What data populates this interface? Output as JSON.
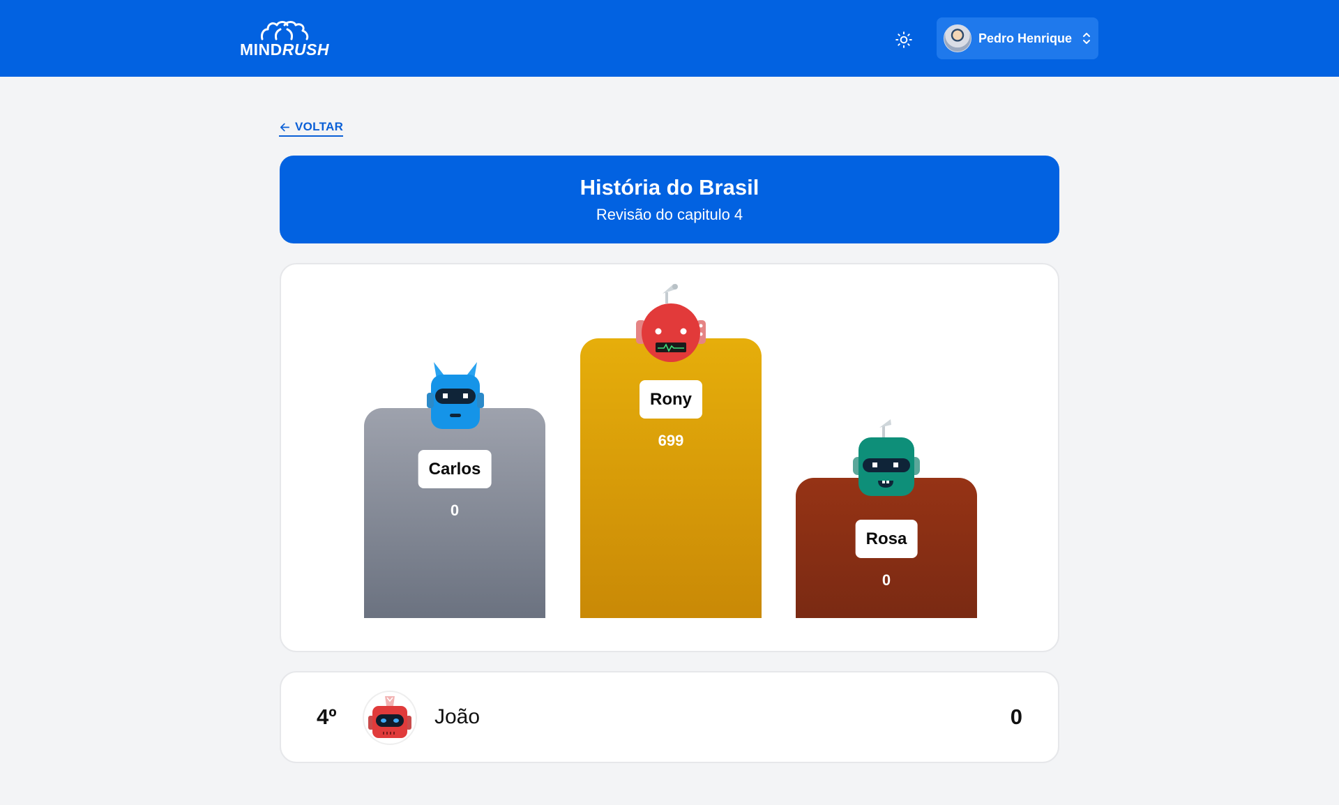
{
  "header": {
    "logo_prefix": "MIND",
    "logo_suffix": "RUSH",
    "user_name": "Pedro Henrique",
    "theme_icon": "sun-icon",
    "user_menu_icon": "chevron-up-down-icon",
    "brand_color": "#0262e1"
  },
  "nav": {
    "back_label": "VOLTAR",
    "back_icon": "arrow-left-icon"
  },
  "quiz": {
    "title": "História do Brasil",
    "subtitle": "Revisão do capitulo 4"
  },
  "podium": [
    {
      "place": 1,
      "name": "Rony",
      "score": "699",
      "avatar": "red-robot-antenna-icon",
      "color": "#e0a909"
    },
    {
      "place": 2,
      "name": "Carlos",
      "score": "0",
      "avatar": "blue-robot-horns-icon",
      "color": "#9ca3af"
    },
    {
      "place": 3,
      "name": "Rosa",
      "score": "0",
      "avatar": "teal-robot-antenna-icon",
      "color": "#8b3114"
    }
  ],
  "ranking": [
    {
      "position": "4º",
      "name": "João",
      "score": "0",
      "avatar": "red-robot-icon"
    }
  ]
}
